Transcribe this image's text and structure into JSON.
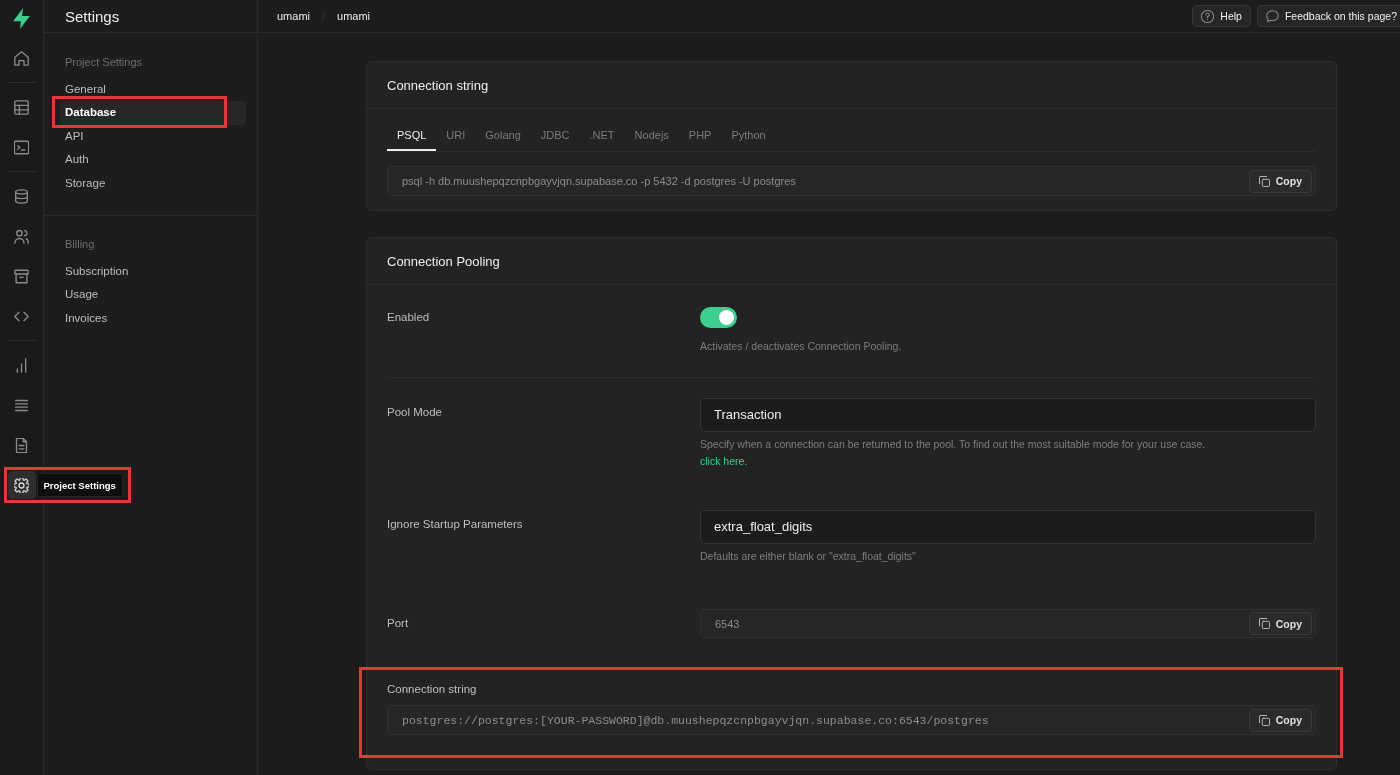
{
  "rail": {
    "groups": [
      {
        "items": [
          {
            "kind": "home",
            "selected": false
          }
        ]
      },
      {
        "items": [
          {
            "kind": "table",
            "selected": false
          },
          {
            "kind": "terminal",
            "selected": false
          }
        ]
      },
      {
        "items": [
          {
            "kind": "database",
            "selected": false
          },
          {
            "kind": "users",
            "selected": false
          },
          {
            "kind": "archive",
            "selected": false
          },
          {
            "kind": "code",
            "selected": false
          }
        ]
      },
      {
        "items": [
          {
            "kind": "chart",
            "selected": false
          },
          {
            "kind": "list",
            "selected": false
          },
          {
            "kind": "document",
            "selected": false
          },
          {
            "kind": "settings",
            "selected": true,
            "tooltip": {
              "label": "Project Settings",
              "highlighted": true
            }
          }
        ]
      }
    ]
  },
  "sidebar": {
    "title": "Settings",
    "sections": [
      {
        "heading": "Project Settings",
        "items": [
          {
            "label": "General",
            "selected": false,
            "highlighted": false
          },
          {
            "label": "Database",
            "selected": true,
            "highlighted": true
          },
          {
            "label": "API",
            "selected": false,
            "highlighted": false
          },
          {
            "label": "Auth",
            "selected": false,
            "highlighted": false
          },
          {
            "label": "Storage",
            "selected": false,
            "highlighted": false
          }
        ]
      },
      {
        "heading": "Billing",
        "items": [
          {
            "label": "Subscription",
            "selected": false,
            "highlighted": false
          },
          {
            "label": "Usage",
            "selected": false,
            "highlighted": false
          },
          {
            "label": "Invoices",
            "selected": false,
            "highlighted": false
          }
        ]
      }
    ]
  },
  "top_bar": {
    "breadcrumb": [
      "umami",
      "umami"
    ],
    "buttons": [
      {
        "kind": "help",
        "label": "Help"
      },
      {
        "kind": "feedback",
        "label": "Feedback on this page?"
      }
    ]
  },
  "connection_string": {
    "title": "Connection string",
    "tabs": [
      {
        "label": "PSQL",
        "selected": true
      },
      {
        "label": "URI",
        "selected": false
      },
      {
        "label": "Golang",
        "selected": false
      },
      {
        "label": "JDBC",
        "selected": false
      },
      {
        "label": ".NET",
        "selected": false
      },
      {
        "label": "Nodejs",
        "selected": false
      },
      {
        "label": "PHP",
        "selected": false
      },
      {
        "label": "Python",
        "selected": false
      }
    ],
    "value": "psql -h db.muushepqzcnpbgayvjqn.supabase.co -p 5432 -d postgres -U postgres",
    "copy_label": "Copy"
  },
  "connection_pooling": {
    "title": "Connection Pooling",
    "rows": [
      {
        "kind": "toggle",
        "label": "Enabled",
        "on": true,
        "description": "Activates / deactivates Connection Pooling.",
        "highlighted": false
      },
      {
        "kind": "input",
        "label": "Pool Mode",
        "value": "Transaction",
        "description": "Specify when a connection can be returned to the pool. To find out the most suitable mode for your use case.",
        "link": "click here.",
        "highlighted": false
      },
      {
        "kind": "input",
        "label": "Ignore Startup Parameters",
        "value": "extra_float_digits",
        "description": "Defaults are either blank or \"extra_float_digits\"",
        "highlighted": false
      },
      {
        "kind": "readonly",
        "label": "Port",
        "value": "6543",
        "copy_label": "Copy",
        "highlighted": false
      },
      {
        "kind": "uri",
        "label": "Connection string",
        "value": "postgres://postgres:[YOUR-PASSWORD]@db.muushepqzcnpbgayvjqn.supabase.co:6543/postgres",
        "copy_label": "Copy",
        "highlighted": true
      }
    ]
  }
}
